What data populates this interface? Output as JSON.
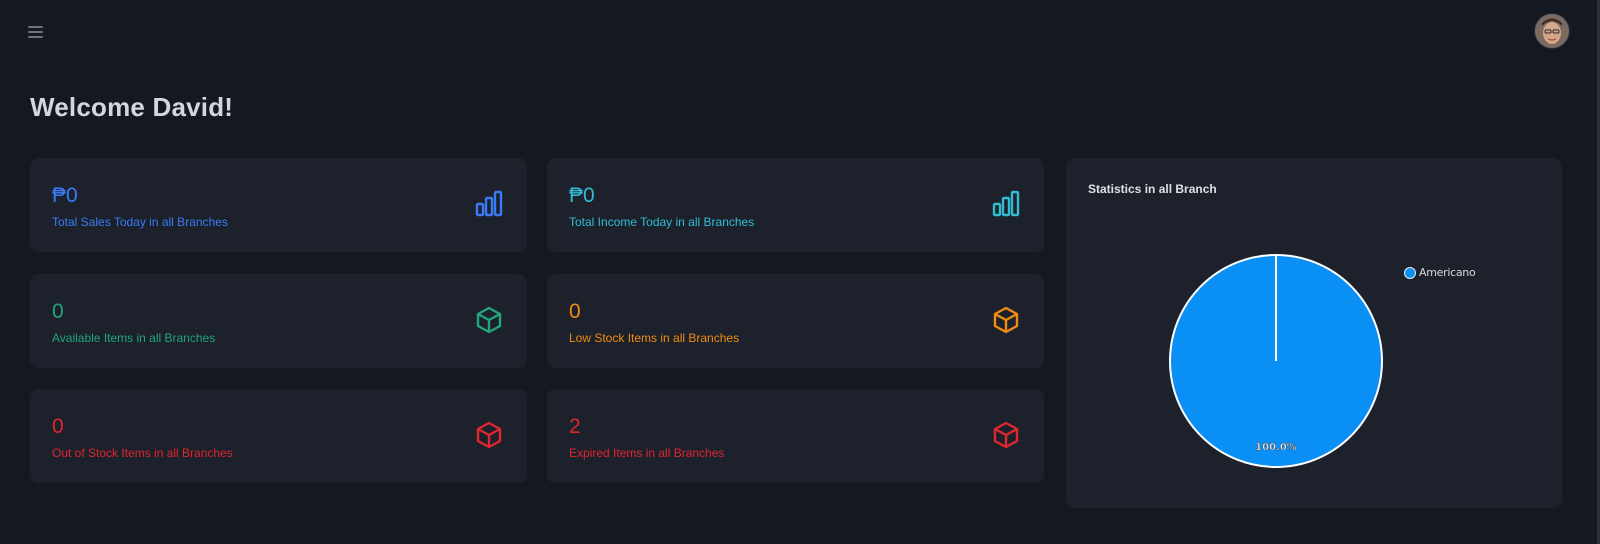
{
  "header": {
    "menu_icon": "hamburger-menu-icon",
    "avatar_icon": "user-avatar"
  },
  "welcome": {
    "title": "Welcome David!"
  },
  "cards": [
    {
      "value": "₱0",
      "label": "Total Sales Today in all Branches",
      "icon": "bar-chart-icon",
      "color": "#3b7bf5"
    },
    {
      "value": "₱0",
      "label": "Total Income Today in all Branches",
      "icon": "bar-chart-icon",
      "color": "#31bcd4"
    },
    {
      "value": "0",
      "label": "Available Items in all Branches",
      "icon": "box-icon",
      "color": "#22a57a"
    },
    {
      "value": "0",
      "label": "Low Stock Items in all Branches",
      "icon": "box-icon",
      "color": "#f08c12"
    },
    {
      "value": "0",
      "label": "Out of Stock Items in all Branches",
      "icon": "box-icon",
      "color": "#e0262e"
    },
    {
      "value": "2",
      "label": "Expired Items in all Branches",
      "icon": "box-icon",
      "color": "#e0262e"
    }
  ],
  "chart": {
    "title": "Statistics in all Branch"
  },
  "chart_data": {
    "type": "pie",
    "title": "Statistics in all Branch",
    "categories": [
      "Americano"
    ],
    "values": [
      100
    ],
    "colors": [
      "#0a8ff5"
    ],
    "data_labels": [
      "100.0%"
    ],
    "legend": "right"
  }
}
